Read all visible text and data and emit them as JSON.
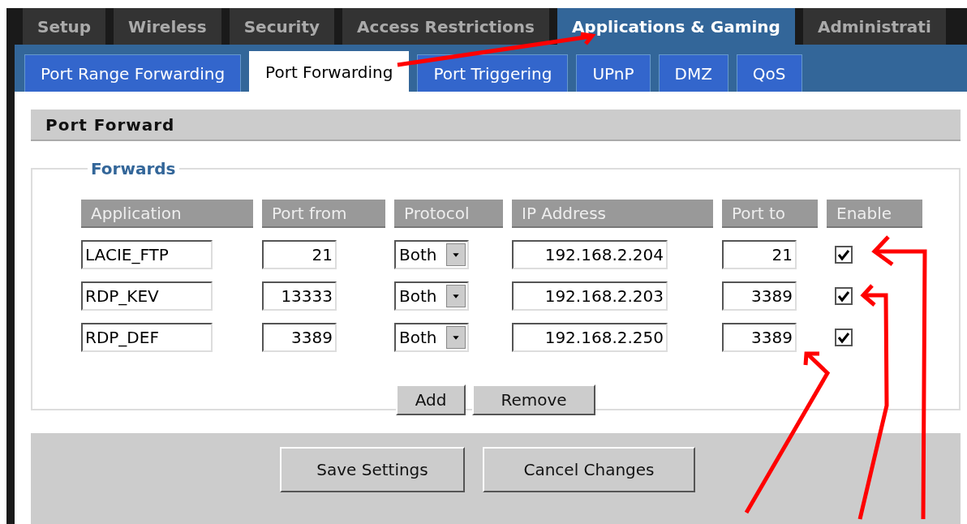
{
  "main_tabs": [
    {
      "label": "Setup",
      "selected": false
    },
    {
      "label": "Wireless",
      "selected": false
    },
    {
      "label": "Security",
      "selected": false
    },
    {
      "label": "Access Restrictions",
      "selected": false
    },
    {
      "label": "Applications & Gaming",
      "selected": true
    },
    {
      "label": "Administrati",
      "selected": false
    }
  ],
  "sub_tabs": [
    {
      "label": "Port Range Forwarding",
      "selected": false
    },
    {
      "label": "Port Forwarding",
      "selected": true
    },
    {
      "label": "Port Triggering",
      "selected": false
    },
    {
      "label": "UPnP",
      "selected": false
    },
    {
      "label": "DMZ",
      "selected": false
    },
    {
      "label": "QoS",
      "selected": false
    }
  ],
  "section_title": "Port Forward",
  "fieldset_legend": "Forwards",
  "table": {
    "columns": [
      "Application",
      "Port from",
      "Protocol",
      "IP Address",
      "Port to",
      "Enable"
    ],
    "rows": [
      {
        "application": "LACIE_FTP",
        "port_from": "21",
        "protocol": "Both",
        "ip_address": "192.168.2.204",
        "port_to": "21",
        "enabled": true
      },
      {
        "application": "RDP_KEV",
        "port_from": "13333",
        "protocol": "Both",
        "ip_address": "192.168.2.203",
        "port_to": "3389",
        "enabled": true
      },
      {
        "application": "RDP_DEF",
        "port_from": "3389",
        "protocol": "Both",
        "ip_address": "192.168.2.250",
        "port_to": "3389",
        "enabled": true
      }
    ]
  },
  "table_buttons": [
    "Add",
    "Remove"
  ],
  "footer_buttons": [
    "Save Settings",
    "Cancel Changes"
  ]
}
